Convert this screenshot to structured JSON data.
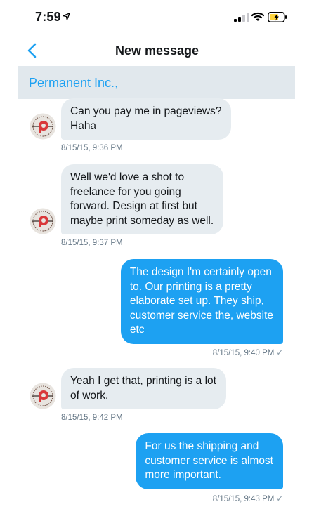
{
  "status": {
    "time": "7:59"
  },
  "nav": {
    "title": "New message"
  },
  "recipient": {
    "name": "Permanent Inc.,"
  },
  "messages": [
    {
      "direction": "in",
      "text": "Can you pay me in pageviews?\nHaha",
      "timestamp": "8/15/15, 9:36 PM"
    },
    {
      "direction": "in",
      "text": "Well we'd love a shot to\nfreelance for you going\nforward. Design at first but\nmaybe print someday as well.",
      "timestamp": "8/15/15, 9:37 PM"
    },
    {
      "direction": "out",
      "text": "The design I'm certainly open\nto. Our printing is a pretty\nelaborate set up.  They ship,\ncustomer service the, website\netc",
      "timestamp": "8/15/15, 9:40 PM",
      "check": "✓"
    },
    {
      "direction": "in",
      "text": "Yeah I get that, printing is a lot\nof work.",
      "timestamp": "8/15/15, 9:42 PM"
    },
    {
      "direction": "out",
      "text": "For us the shipping and\ncustomer service is almost\nmore important.",
      "timestamp": "8/15/15, 9:43 PM",
      "check": "✓"
    }
  ],
  "colors": {
    "accent": "#1da1f2",
    "incoming_bubble": "#e6ecf0",
    "recipient_bar": "#e1e8ed",
    "battery_charging": "#ffd43b"
  },
  "icons": {
    "back": "chevron-left-icon",
    "location": "location-arrow-icon",
    "signal": "cellular-signal-icon",
    "wifi": "wifi-icon",
    "battery": "battery-charging-icon",
    "avatar": "avatar-logo"
  }
}
